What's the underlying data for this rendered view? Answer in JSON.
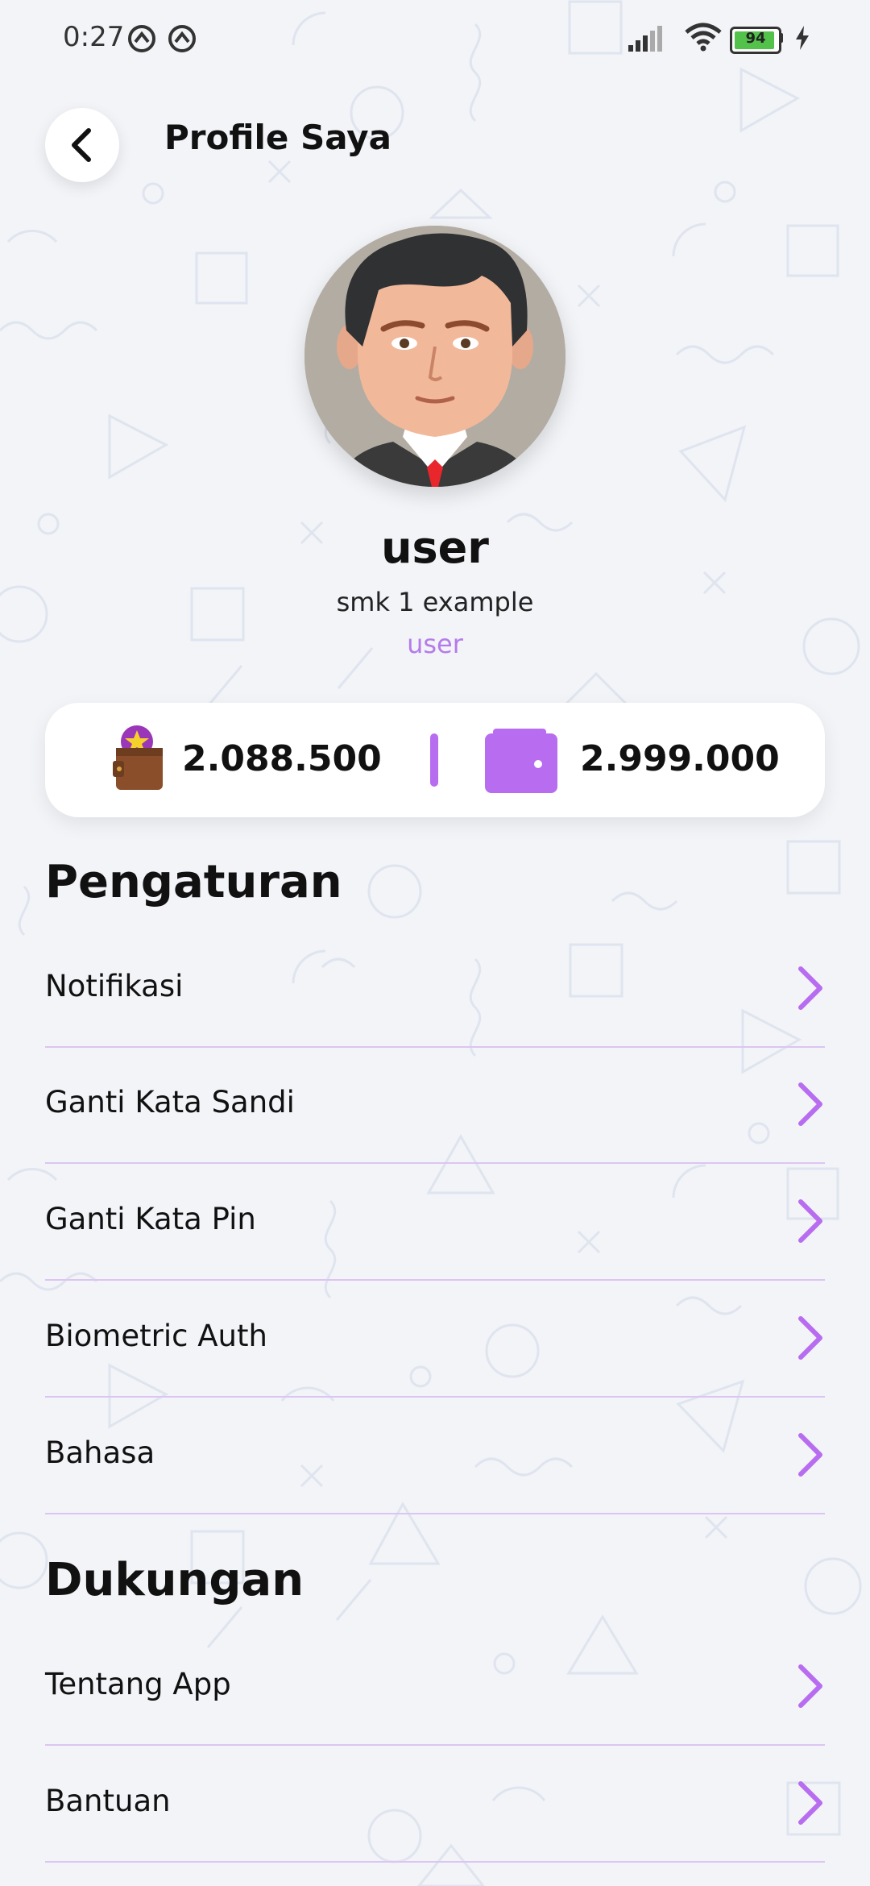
{
  "status_bar": {
    "time": "0:27",
    "battery": "94"
  },
  "header": {
    "title": "Profile Saya"
  },
  "profile": {
    "name": "user",
    "school": "smk 1 example",
    "role": "user"
  },
  "balance": {
    "points": "2.088.500",
    "wallet": "2.999.000"
  },
  "settings": {
    "title": "Pengaturan",
    "items": [
      {
        "label": "Notifikasi"
      },
      {
        "label": "Ganti Kata Sandi"
      },
      {
        "label": "Ganti Kata Pin"
      },
      {
        "label": "Biometric Auth"
      },
      {
        "label": "Bahasa"
      }
    ]
  },
  "support": {
    "title": "Dukungan",
    "items": [
      {
        "label": "Tentang App"
      },
      {
        "label": "Bantuan"
      }
    ]
  },
  "colors": {
    "accent": "#b86cf0",
    "background": "#f2f4f8",
    "role_text": "#b57bea"
  }
}
